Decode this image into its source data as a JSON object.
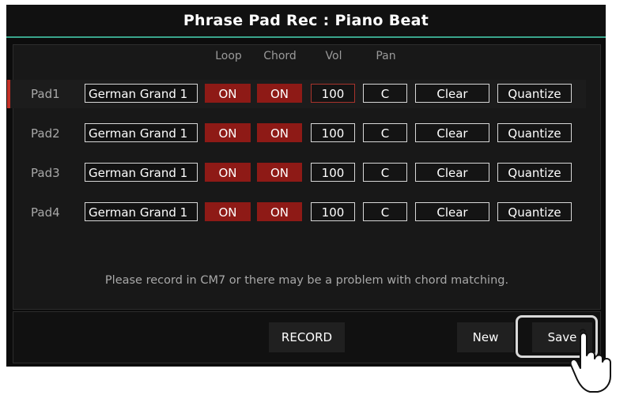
{
  "window": {
    "title": "Phrase Pad Rec : Piano Beat"
  },
  "columns": {
    "loop": "Loop",
    "chord": "Chord",
    "vol": "Vol",
    "pan": "Pan"
  },
  "rows": [
    {
      "pad": "Pad1",
      "voice": "German Grand 1",
      "loop": "ON",
      "chord": "ON",
      "vol": "100",
      "pan": "C",
      "clear": "Clear",
      "quantize": "Quantize"
    },
    {
      "pad": "Pad2",
      "voice": "German Grand 1",
      "loop": "ON",
      "chord": "ON",
      "vol": "100",
      "pan": "C",
      "clear": "Clear",
      "quantize": "Quantize"
    },
    {
      "pad": "Pad3",
      "voice": "German Grand 1",
      "loop": "ON",
      "chord": "ON",
      "vol": "100",
      "pan": "C",
      "clear": "Clear",
      "quantize": "Quantize"
    },
    {
      "pad": "Pad4",
      "voice": "German Grand 1",
      "loop": "ON",
      "chord": "ON",
      "vol": "100",
      "pan": "C",
      "clear": "Clear",
      "quantize": "Quantize"
    }
  ],
  "note": "Please record in CM7 or there may be a problem with chord matching.",
  "buttons": {
    "record": "RECORD",
    "new": "New",
    "save": "Save"
  },
  "icons": {
    "pointer": "hand-pointer-icon"
  },
  "colors": {
    "accent_line": "#3aa58c",
    "on_red": "#8e1a16",
    "selected_marker": "#c43027"
  }
}
